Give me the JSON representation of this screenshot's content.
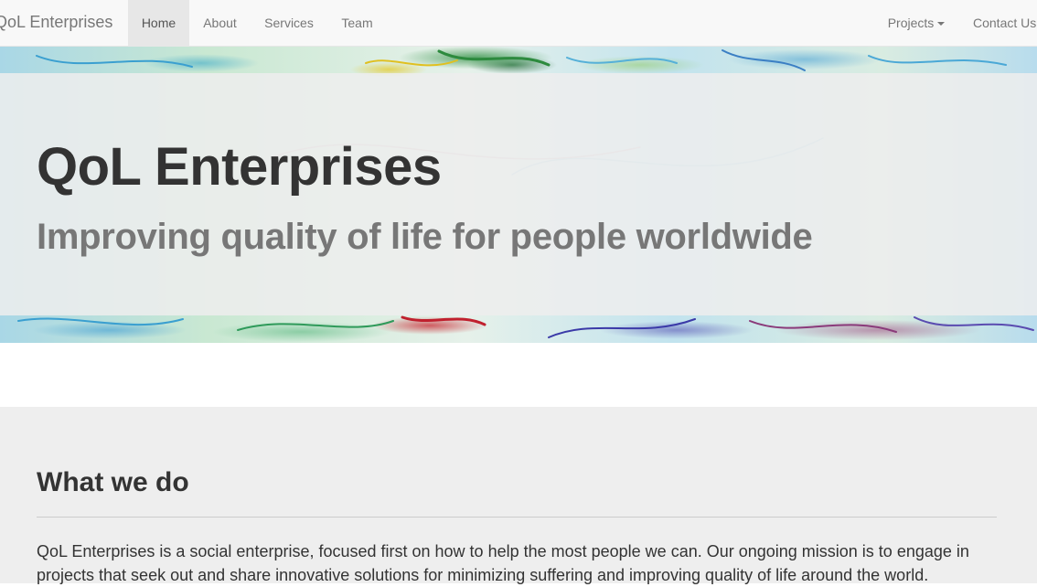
{
  "navbar": {
    "brand": "QoL Enterprises",
    "items": [
      {
        "label": "Home",
        "active": true
      },
      {
        "label": "About"
      },
      {
        "label": "Services"
      },
      {
        "label": "Team"
      }
    ],
    "right_items": [
      {
        "label": "Projects",
        "dropdown": true
      },
      {
        "label": "Contact Us"
      }
    ]
  },
  "hero": {
    "title": "QoL Enterprises",
    "subtitle": "Improving quality of life for people worldwide"
  },
  "about_section": {
    "heading": "What we do",
    "body": "QoL Enterprises is a social enterprise, focused first on how to help the most people we can. Our ongoing mission is to engage in projects that seek out and share innovative solutions for minimizing suffering and improving quality of life around the world."
  },
  "colors": {
    "navbar_bg": "#f8f8f8",
    "nav_active_bg": "#e7e7e7",
    "nav_text": "#777777",
    "hero_panel": "#eeeeee",
    "section_bg": "#eeeeee",
    "heading_text": "#333333",
    "subtitle_text": "#777777"
  }
}
